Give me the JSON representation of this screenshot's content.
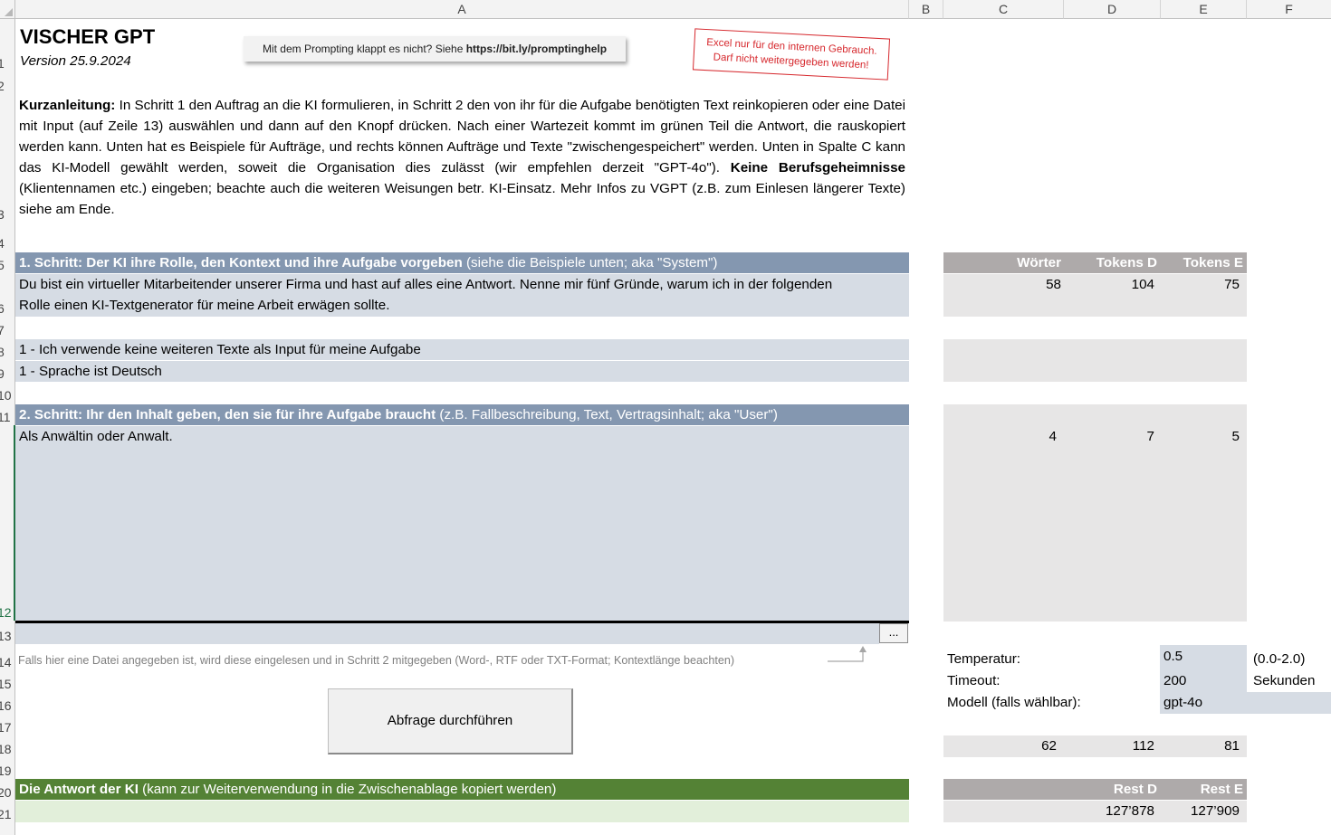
{
  "columns": [
    "A",
    "B",
    "C",
    "D",
    "E",
    "F"
  ],
  "rows": [
    "1",
    "2",
    "3",
    "4",
    "5",
    "6",
    "7",
    "8",
    "9",
    "10",
    "11",
    "12",
    "13",
    "14",
    "15",
    "16",
    "17",
    "18",
    "19",
    "20",
    "21"
  ],
  "header": {
    "title": "VISCHER GPT",
    "version": "Version 25.9.2024",
    "hint_prefix": "Mit dem Prompting klappt es nicht? Siehe ",
    "hint_link": "https://bit.ly/promptinghelp",
    "stamp_line1": "Excel nur für den internen Gebrauch.",
    "stamp_line2": "Darf nicht weitergegeben werden!"
  },
  "intro": {
    "bold1": "Kurzanleitung:",
    "text1": " In Schritt 1 den Auftrag an die KI formulieren, in Schritt 2 den von ihr für die Aufgabe benötigten Text reinkopieren oder eine Datei mit Input (auf Zeile 13) auswählen und dann auf den Knopf drücken. Nach einer Wartezeit kommt im grünen Teil die Antwort, die rauskopiert werden kann. Unten hat es Beispiele für Aufträge, und rechts können Aufträge und Texte \"zwischengespeichert\" werden. Unten in Spalte C kann das KI-Modell gewählt werden, soweit die Organisation dies zulässt (wir empfehlen derzeit \"GPT-4o\"). ",
    "bold2": "Keine Berufsgeheimnisse",
    "text2": " (Klientennamen etc.) eingeben; beachte auch die weiteren Weisungen betr. KI-Einsatz. Mehr Infos zu VGPT (z.B. zum Einlesen längerer Texte) siehe am Ende."
  },
  "step1": {
    "title_bold": "1. Schritt: Der KI ihre Rolle, den Kontext und ihre Aufgabe vorgeben",
    "title_rest": " (siehe die Beispiele unten; aka \"System\")",
    "line1": "Du bist ein virtueller Mitarbeitender unserer Firma und hast auf alles eine Antwort. Nenne mir fünf Gründe, warum ich in der folgenden",
    "line2": "Rolle einen KI-Textgenerator für meine Arbeit erwägen sollte.",
    "option_input": "1 - Ich verwende keine weiteren Texte als Input für meine Aufgabe",
    "option_lang": "1 - Sprache ist Deutsch"
  },
  "step2": {
    "title_bold": "2. Schritt: Ihr den Inhalt geben, den sie für ihre Aufgabe braucht",
    "title_rest": " (z.B. Fallbeschreibung, Text, Vertragsinhalt; aka \"User\")",
    "content": "Als Anwältin oder Anwalt.",
    "file_value": "",
    "file_button": "...",
    "file_hint": "Falls hier eine Datei angegeben ist, wird diese eingelesen und in Schritt 2 mitgegeben (Word-, RTF oder TXT-Format; Kontextlänge beachten)"
  },
  "run_button": "Abfrage durchführen",
  "answer": {
    "title_bold": "Die Antwort der KI",
    "title_rest": " (kann zur Weiterverwendung in die Zwischenablage kopiert werden)",
    "content": ""
  },
  "stats": {
    "headers": [
      "Wörter",
      "Tokens D",
      "Tokens E"
    ],
    "step1": [
      "58",
      "104",
      "75"
    ],
    "step2": [
      "4",
      "7",
      "5"
    ],
    "total": [
      "62",
      "112",
      "81"
    ],
    "rest_headers": [
      "Rest D",
      "Rest E"
    ],
    "rest": [
      "127’878",
      "127’909"
    ]
  },
  "settings": {
    "temp_label": "Temperatur:",
    "temp_value": "0.5",
    "temp_range": "(0.0-2.0)",
    "timeout_label": "Timeout:",
    "timeout_value": "200",
    "timeout_unit": "Sekunden",
    "model_label": "Modell (falls wählbar):",
    "model_value": "gpt-4o"
  },
  "colors": {
    "step_header": "#8497b0",
    "input_fill": "#d6dce4",
    "answer_header": "#548235",
    "answer_fill": "#e2efda",
    "stats_header": "#aeaaaa",
    "stats_fill": "#e7e6e6",
    "stamp": "#d6282d"
  }
}
